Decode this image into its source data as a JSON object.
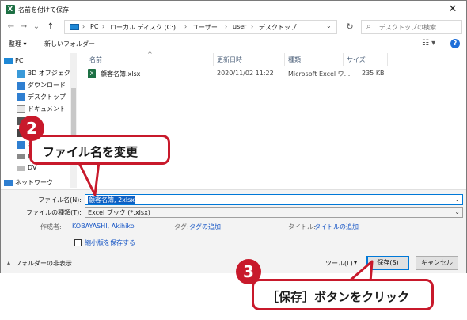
{
  "window": {
    "title": "名前を付けて保存",
    "app_icon": "excel-icon",
    "close_symbol": "✕"
  },
  "nav": {
    "back": "←",
    "forward": "→",
    "dropdown": "⌄",
    "up": "↑",
    "breadcrumb": [
      "PC",
      "ローカル ディスク (C:)",
      "ユーザー",
      "user",
      "デスクトップ"
    ],
    "separator": "›",
    "address_dropdown": "⌄",
    "refresh": "↻",
    "search_placeholder": "デスクトップの検索",
    "search_icon": "⌕"
  },
  "toolbar": {
    "organize": "整理 ▾",
    "new_folder": "新しいフォルダー",
    "view": "☷ ▾",
    "help": "?"
  },
  "sidebar": {
    "items": [
      {
        "label": "PC",
        "icon": "pc-icon"
      },
      {
        "label": "3D オブジェクト",
        "icon": "3d-objects-icon"
      },
      {
        "label": "ダウンロード",
        "icon": "download-icon"
      },
      {
        "label": "デスクトップ",
        "icon": "desktop-icon"
      },
      {
        "label": "ドキュメント",
        "icon": "documents-icon"
      },
      {
        "label": "ピ",
        "icon": "pictures-icon"
      },
      {
        "label": "ビ",
        "icon": "video-icon"
      },
      {
        "label": "ミュ",
        "icon": "music-icon"
      },
      {
        "label": "ロー",
        "icon": "local-disk-icon"
      },
      {
        "label": "DV",
        "icon": "dvd-icon"
      },
      {
        "label": "ネットワーク",
        "icon": "network-icon"
      }
    ]
  },
  "columns": {
    "name": "名前",
    "modified": "更新日時",
    "type": "種類",
    "size": "サイズ",
    "sort_indicator": "^"
  },
  "files": [
    {
      "name": "顧客名簿.xlsx",
      "modified": "2020/11/02 11:22",
      "type": "Microsoft Excel ワ...",
      "size": "235 KB"
    }
  ],
  "form": {
    "filename_label": "ファイル名(N):",
    "filename_value": "顧客名簿, 2xlsx",
    "filetype_label": "ファイルの種類(T):",
    "filetype_value": "Excel ブック (*.xlsx)",
    "author_label": "作成者:",
    "author_value": "KOBAYASHI, Akihiko",
    "tags_label": "タグ:",
    "tags_value": "タグの追加",
    "title_label": "タイトル:",
    "title_value": "タイトルの追加",
    "thumbnail_label": "縮小版を保存する"
  },
  "footer": {
    "hide_folders": "フォルダーの非表示",
    "hide_folders_icon": "▴",
    "tools": "ツール(L)",
    "tools_arrow": "▾",
    "save": "保存(S)",
    "cancel": "キャンセル"
  },
  "annotations": {
    "step2_number": "2",
    "step2_text": "ファイル名を変更",
    "step3_number": "3",
    "step3_text": "［保存］ボタンをクリック",
    "accent_color": "#c8192b"
  }
}
